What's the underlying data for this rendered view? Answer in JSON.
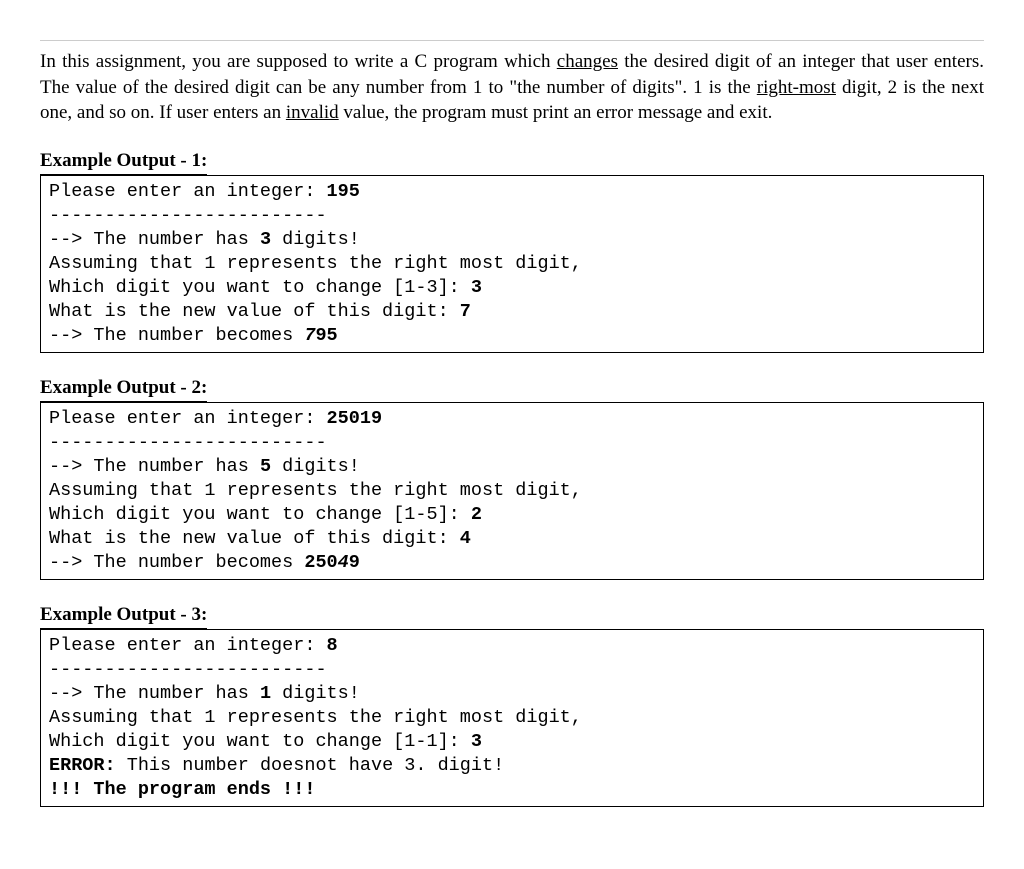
{
  "intro": {
    "part1": "In this assignment, you are supposed to write a C program which ",
    "changes": "changes",
    "part2": " the desired digit of an integer that user enters. The value of the desired digit can be any number from 1 to \"the number of digits\". 1 is the ",
    "rightmost": "right-most",
    "part3": " digit, 2 is the next one, and so on. If user enters an ",
    "invalid": "invalid",
    "part4": " value, the program must print an error message and exit."
  },
  "examples": [
    {
      "title": "Example Output - 1:",
      "lines": [
        {
          "segments": [
            {
              "t": "Please enter an integer: "
            },
            {
              "t": "195",
              "style": "bold"
            }
          ]
        },
        {
          "segments": [
            {
              "t": "-------------------------"
            }
          ]
        },
        {
          "segments": [
            {
              "t": "--> The number has "
            },
            {
              "t": "3",
              "style": "bold"
            },
            {
              "t": " digits!"
            }
          ]
        },
        {
          "segments": [
            {
              "t": "Assuming that 1 represents the right most digit,"
            }
          ]
        },
        {
          "segments": [
            {
              "t": "Which digit you want to change [1-3]: "
            },
            {
              "t": "3",
              "style": "bold"
            }
          ]
        },
        {
          "segments": [
            {
              "t": "What is the new value of this digit: "
            },
            {
              "t": "7",
              "style": "bold"
            }
          ]
        },
        {
          "segments": [
            {
              "t": "--> The number becomes "
            },
            {
              "t": "7",
              "style": "bolditalic"
            },
            {
              "t": "95",
              "style": "bold"
            }
          ]
        }
      ]
    },
    {
      "title": "Example Output - 2:",
      "lines": [
        {
          "segments": [
            {
              "t": "Please enter an integer: "
            },
            {
              "t": "25019",
              "style": "bold"
            }
          ]
        },
        {
          "segments": [
            {
              "t": "-------------------------"
            }
          ]
        },
        {
          "segments": [
            {
              "t": "--> The number has "
            },
            {
              "t": "5",
              "style": "bold"
            },
            {
              "t": " digits!"
            }
          ]
        },
        {
          "segments": [
            {
              "t": "Assuming that 1 represents the right most digit,"
            }
          ]
        },
        {
          "segments": [
            {
              "t": "Which digit you want to change [1-5]: "
            },
            {
              "t": "2",
              "style": "bold"
            }
          ]
        },
        {
          "segments": [
            {
              "t": "What is the new value of this digit: "
            },
            {
              "t": "4",
              "style": "bold"
            }
          ]
        },
        {
          "segments": [
            {
              "t": "--> The number becomes "
            },
            {
              "t": "250",
              "style": "bold"
            },
            {
              "t": "4",
              "style": "bolditalic"
            },
            {
              "t": "9",
              "style": "bold"
            }
          ]
        }
      ]
    },
    {
      "title": "Example Output - 3:",
      "lines": [
        {
          "segments": [
            {
              "t": "Please enter an integer: "
            },
            {
              "t": "8",
              "style": "bold"
            }
          ]
        },
        {
          "segments": [
            {
              "t": "-------------------------"
            }
          ]
        },
        {
          "segments": [
            {
              "t": "--> The number has "
            },
            {
              "t": "1",
              "style": "bold"
            },
            {
              "t": " digits!"
            }
          ]
        },
        {
          "segments": [
            {
              "t": "Assuming that 1 represents the right most digit,"
            }
          ]
        },
        {
          "segments": [
            {
              "t": "Which digit you want to change [1-1]: "
            },
            {
              "t": "3",
              "style": "bold"
            }
          ]
        },
        {
          "segments": [
            {
              "t": "ERROR:",
              "style": "bold"
            },
            {
              "t": " This number doesnot have 3. digit!"
            }
          ]
        },
        {
          "segments": [
            {
              "t": "!!! The program ends !!!",
              "style": "bold"
            }
          ]
        }
      ]
    }
  ]
}
